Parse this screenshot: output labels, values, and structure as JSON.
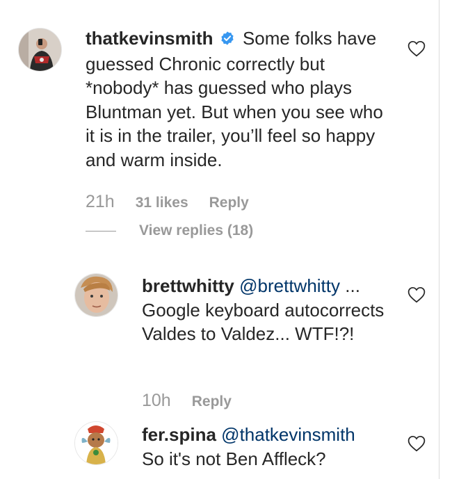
{
  "comments": [
    {
      "username": "thatkevinsmith",
      "verified": true,
      "text": "Some folks have guessed Chronic correctly but *nobody* has guessed who plays Bluntman yet. But when you see who it is in the trailer, you’ll feel so happy and warm inside.",
      "time": "21h",
      "likes": "31 likes",
      "reply_label": "Reply",
      "view_replies": "View replies (18)"
    },
    {
      "username": "brettwhitty",
      "mention": "@brettwhitty",
      "text": "... Google keyboard autocorrects Valdes to Valdez... WTF!?!",
      "time": "10h",
      "reply_label": "Reply"
    },
    {
      "username": "fer.spina",
      "mention": "@thatkevinsmith",
      "text": "So it's not Ben Affleck?"
    }
  ],
  "icons": {
    "like": "heart-outline-icon",
    "verified": "verified-badge-icon"
  },
  "colors": {
    "text": "#262626",
    "muted": "#999999",
    "mention": "#003569",
    "verified": "#3897f0"
  }
}
